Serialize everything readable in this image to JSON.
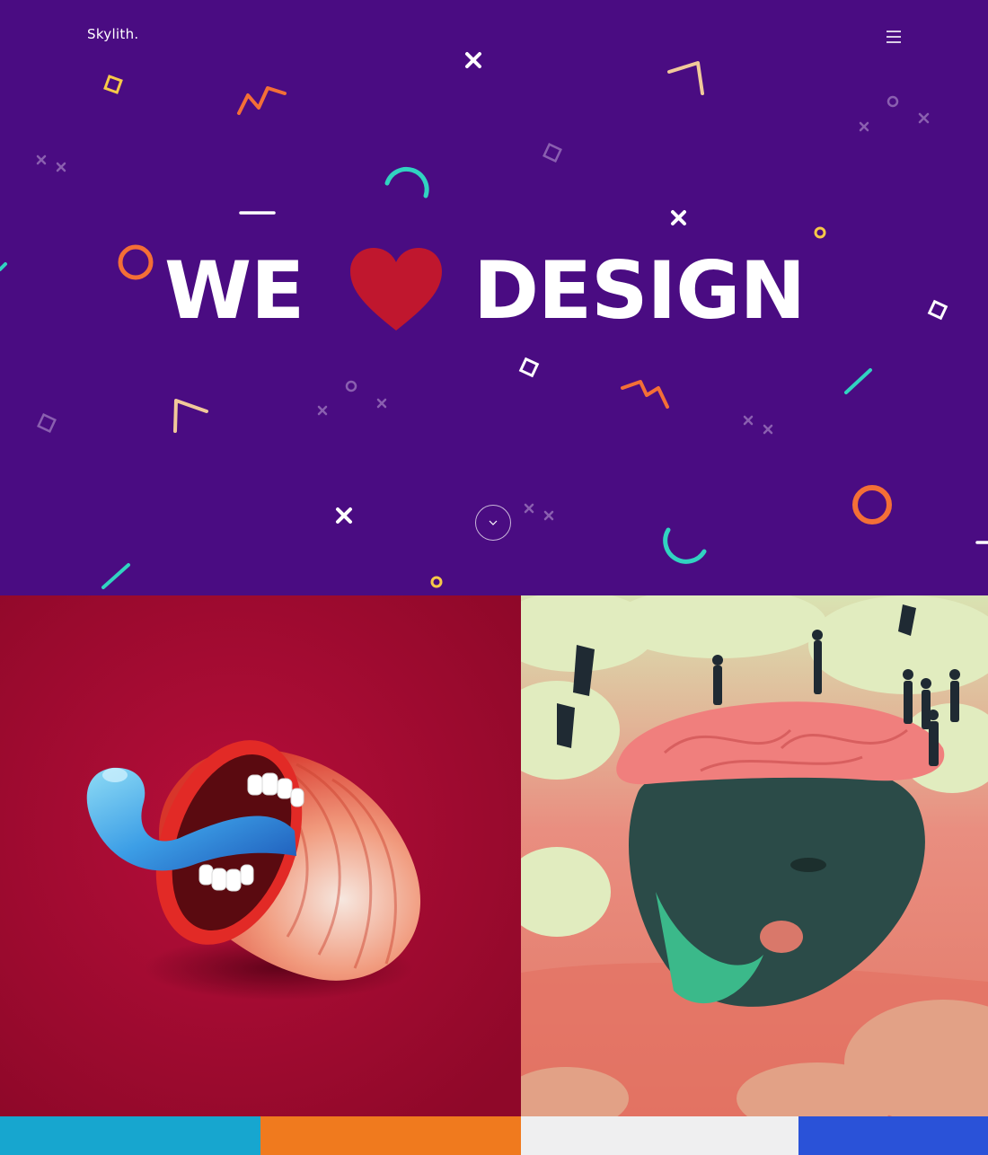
{
  "header": {
    "logo_text": "Skylith.",
    "menu_icon": "hamburger-menu-icon"
  },
  "hero": {
    "headline_left": "WE",
    "headline_icon": "heart-icon",
    "headline_right": "DESIGN",
    "background_color": "#4a0c82",
    "heart_color": "#c0172e",
    "scroll_icon": "chevron-down-icon"
  },
  "portfolio": {
    "items": [
      {
        "title": "",
        "image": "cartoon-mouth-tongue-illustration",
        "background_color": "#a30a32"
      },
      {
        "title": "",
        "image": "surreal-head-island-illustration",
        "background_color": "#e88a7b"
      }
    ],
    "strip_colors": [
      "#17a6cf",
      "#f07a1e",
      "#efeff0",
      "#2a52d8"
    ]
  }
}
